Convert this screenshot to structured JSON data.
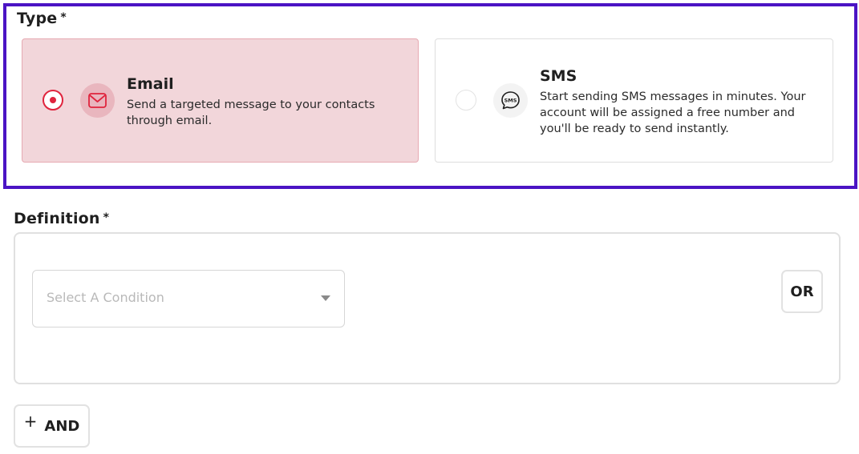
{
  "type_section": {
    "label": "Type",
    "required_mark": "*",
    "options": [
      {
        "title": "Email",
        "description": "Send a targeted message to your contacts through email.",
        "selected": true,
        "icon": "envelope-icon"
      },
      {
        "title": "SMS",
        "description": "Start sending SMS messages in minutes. Your account will be assigned a free number and you'll be ready to send instantly.",
        "selected": false,
        "icon": "sms-bubble-icon",
        "icon_text": "SMS"
      }
    ]
  },
  "definition_section": {
    "label": "Definition",
    "required_mark": "*",
    "condition_select": {
      "placeholder": "Select A Condition"
    },
    "or_button": "OR",
    "and_button": {
      "plus": "+",
      "label": "AND"
    }
  },
  "colors": {
    "highlight_border": "#4b14c4",
    "accent": "#e0243d",
    "selected_card_bg": "#f2d6da"
  }
}
